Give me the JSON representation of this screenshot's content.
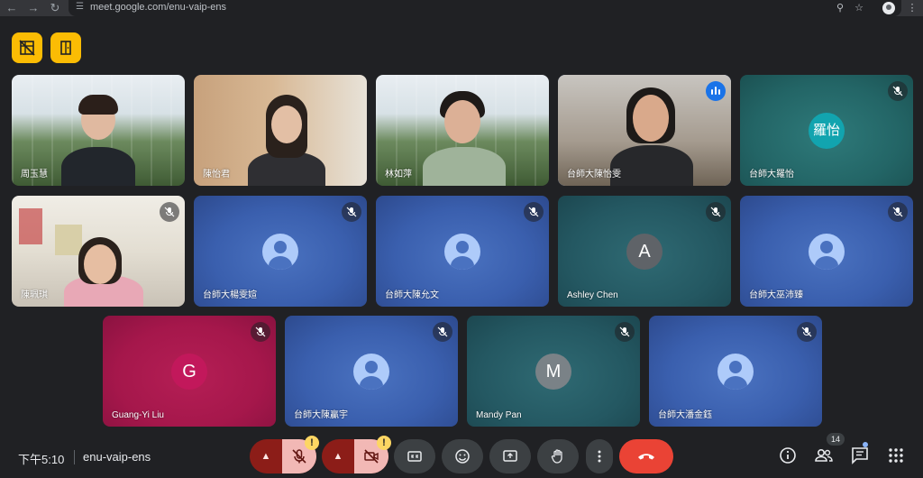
{
  "browser": {
    "url": "meet.google.com/enu-vaip-ens"
  },
  "top_actions": [
    "grid-off-icon",
    "door-icon"
  ],
  "tiles": [
    {
      "name": "周玉慧",
      "type": "video"
    },
    {
      "name": "陳怡君",
      "type": "video"
    },
    {
      "name": "林如萍",
      "type": "video"
    },
    {
      "name": "台師大陳怡雯",
      "type": "video",
      "speaking": true
    },
    {
      "name": "台師大羅怡",
      "type": "avatar",
      "avatar_text": "羅怡",
      "muted": true
    },
    {
      "name": "陳珮琪",
      "type": "video",
      "muted": true
    },
    {
      "name": "台師大楊雯媗",
      "type": "person-icon",
      "muted": true
    },
    {
      "name": "台師大陳允文",
      "type": "person-icon",
      "muted": true
    },
    {
      "name": "Ashley Chen",
      "type": "letter",
      "initial": "A",
      "muted": true
    },
    {
      "name": "台師大巫沛臻",
      "type": "person-icon",
      "muted": true
    },
    {
      "name": "Guang-Yi Liu",
      "type": "letter",
      "initial": "G",
      "muted": true
    },
    {
      "name": "台師大陳贏宇",
      "type": "person-icon",
      "muted": true
    },
    {
      "name": "Mandy Pan",
      "type": "letter",
      "initial": "M",
      "muted": true
    },
    {
      "name": "台師大潘金鈺",
      "type": "person-icon",
      "muted": true
    }
  ],
  "footer": {
    "time": "下午5:10",
    "meeting_code": "enu-vaip-ens",
    "warning_symbol": "!",
    "participant_count": "14"
  },
  "colors": {
    "accent_yellow": "#fbbc04",
    "hangup_red": "#ea4335",
    "muted_control": "#f2b8b5",
    "tile_blue": "#3a5fae",
    "tile_teal": "#236566",
    "tile_magenta": "#a5174b",
    "avatar_teal": "#12a4af",
    "letter_gray": "#5f6368",
    "letter_pink": "#c2185b"
  }
}
